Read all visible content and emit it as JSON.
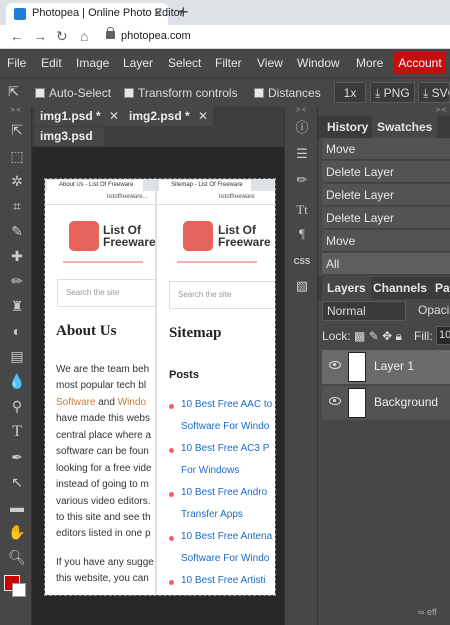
{
  "browser": {
    "tab_title": "Photopea | Online Photo Editor",
    "tab_close": "✕",
    "new_tab": "+",
    "url": "photopea.com",
    "back": "←",
    "forward": "→",
    "reload": "↻",
    "home": "⌂"
  },
  "menu": {
    "items": [
      "File",
      "Edit",
      "Image",
      "Layer",
      "Select",
      "Filter",
      "View",
      "Window",
      "More"
    ],
    "account": "Account",
    "account_color": "#c40f0f"
  },
  "options": {
    "auto_select": "Auto-Select",
    "transform_controls": "Transform controls",
    "distances": "Distances",
    "zoom": "1x",
    "png": "PNG",
    "svg": "SVG"
  },
  "doc_tabs": [
    {
      "label": "img1.psd *",
      "close": "✕"
    },
    {
      "label": "img2.psd *",
      "close": "✕"
    },
    {
      "label": "img3.psd"
    }
  ],
  "canvas": {
    "left": {
      "tab": "About Us - List Of Freeware",
      "url": "listoffreeware...",
      "logo": [
        "List Of",
        "Freeware"
      ],
      "search": "Search the site",
      "heading": "About Us",
      "lines": [
        "We are the team beh",
        "most popular tech bl",
        "Software",
        "and",
        "Windo",
        "have made this webs",
        "central place where a",
        "software can be foun",
        "looking for a free vide",
        "instead of going to m",
        "various video editors.",
        "to this site and see th",
        "editors listed in one p",
        "If you have any sugge",
        "this website, you can"
      ]
    },
    "right": {
      "tab": "Sitemap - List Of Freeware",
      "url": "listoffreeware",
      "logo": [
        "List Of",
        "Freeware"
      ],
      "search": "Search the site",
      "heading": "Sitemap",
      "posts": "Posts",
      "links": [
        "10 Best Free AAC to",
        "Software For Windo",
        "10 Best Free AC3 P",
        "For Windows",
        "10 Best Free Andro",
        "Transfer Apps",
        "10 Best Free Antena",
        "Software For Windo",
        "10 Best Free Artisti"
      ]
    }
  },
  "panels": {
    "arrows": "> <",
    "history_tab": "History",
    "swatches_tab": "Swatches",
    "history": [
      "Move",
      "Delete Layer",
      "Delete Layer",
      "Delete Layer",
      "Move",
      "All"
    ],
    "layers_tab": "Layers",
    "channels_tab": "Channels",
    "paths_tab": "Pa",
    "blend_mode": "Normal",
    "opacity_label": "Opaci",
    "lock_label": "Lock:",
    "fill_label": "Fill:",
    "fill_value": "10",
    "layers": [
      "Layer 1",
      "Background"
    ],
    "bottom": "eff"
  },
  "colors": {
    "foreground": "#cc0000",
    "background": "#ffffff",
    "accent": "#c40f0f"
  }
}
